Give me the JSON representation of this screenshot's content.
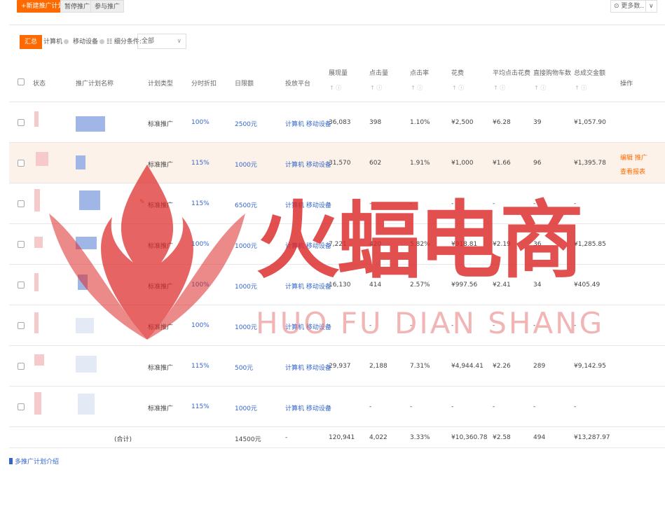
{
  "toolbar": {
    "new_plan": "+新建推广计划",
    "pause": "暂停推广",
    "join": "参与推广",
    "more_data": "⊙ 更多数..",
    "more_caret": "∨"
  },
  "filter": {
    "tabs": [
      "汇总",
      "计算机",
      "移动设备"
    ],
    "segment_label": "☷ 细分条件:",
    "segment_value": "全部",
    "segment_caret": "∨"
  },
  "table": {
    "headers": {
      "status": "状态",
      "name": "推广计划名称",
      "type": "计划类型",
      "discount": "分时折扣",
      "budget": "日限额",
      "platform": "投放平台",
      "impressions": "展现量",
      "clicks": "点击量",
      "ctr": "点击率",
      "cost": "花费",
      "cpc": "平均点击花费",
      "cart": "直接购物车数",
      "gmv": "总成交金额",
      "ops": "操作"
    },
    "sort_mark": "↑ ⓘ",
    "rows": [
      {
        "type": "标准推广",
        "discount": "100%",
        "budget": "2500元",
        "platform": "计算机 移动设备",
        "impressions": "36,083",
        "clicks": "398",
        "ctr": "1.10%",
        "cost": "¥2,500",
        "cpc": "¥6.28",
        "cart": "39",
        "gmv": "¥1,057.90"
      },
      {
        "type": "标准推广",
        "discount": "115%",
        "budget": "1000元",
        "platform": "计算机 移动设备",
        "impressions": "31,570",
        "clicks": "602",
        "ctr": "1.91%",
        "cost": "¥1,000",
        "cpc": "¥1.66",
        "cart": "96",
        "gmv": "¥1,395.78",
        "op1": "编辑 推广",
        "op2": "查看报表"
      },
      {
        "type": "标准推广",
        "discount": "115%",
        "budget": "6500元",
        "platform": "计算机 移动设备",
        "impressions": "-",
        "clicks": "-",
        "ctr": "-",
        "cost": "-",
        "cpc": "-",
        "cart": "-",
        "gmv": "-"
      },
      {
        "type": "标准推广",
        "discount": "100%",
        "budget": "1000元",
        "platform": "计算机 移动设备",
        "impressions": "7,221",
        "clicks": "420",
        "ctr": "5.82%",
        "cost": "¥918.81",
        "cpc": "¥2.19",
        "cart": "36",
        "gmv": "¥1,285.85"
      },
      {
        "type": "标准推广",
        "discount": "100%",
        "budget": "1000元",
        "platform": "计算机 移动设备",
        "impressions": "16,130",
        "clicks": "414",
        "ctr": "2.57%",
        "cost": "¥997.56",
        "cpc": "¥2.41",
        "cart": "34",
        "gmv": "¥405.49"
      },
      {
        "type": "标准推广",
        "discount": "100%",
        "budget": "1000元",
        "platform": "计算机 移动设备",
        "impressions": "-",
        "clicks": "-",
        "ctr": "-",
        "cost": "-",
        "cpc": "-",
        "cart": "-",
        "gmv": "-"
      },
      {
        "type": "标准推广",
        "discount": "115%",
        "budget": "500元",
        "platform": "计算机 移动设备",
        "impressions": "29,937",
        "clicks": "2,188",
        "ctr": "7.31%",
        "cost": "¥4,944.41",
        "cpc": "¥2.26",
        "cart": "289",
        "gmv": "¥9,142.95"
      },
      {
        "type": "标准推广",
        "discount": "115%",
        "budget": "1000元",
        "platform": "计算机 移动设备",
        "impressions": "-",
        "clicks": "-",
        "ctr": "-",
        "cost": "-",
        "cpc": "-",
        "cart": "-",
        "gmv": "-"
      }
    ],
    "total": {
      "label": "(合计)",
      "budget": "14500元",
      "platform": "-",
      "impressions": "120,941",
      "clicks": "4,022",
      "ctr": "3.33%",
      "cost": "¥10,360.78",
      "cpc": "¥2.58",
      "cart": "494",
      "gmv": "¥13,287.97"
    }
  },
  "footer": {
    "intro_link": "多推广计划介绍"
  },
  "watermark": {
    "cn": "火蝠电商",
    "en": "HUO FU DIAN SHANG"
  },
  "colors": {
    "accent": "#ff6a00",
    "link": "#3366cc",
    "highlight_row": "#fdf2e9",
    "watermark": "#dc2828"
  }
}
